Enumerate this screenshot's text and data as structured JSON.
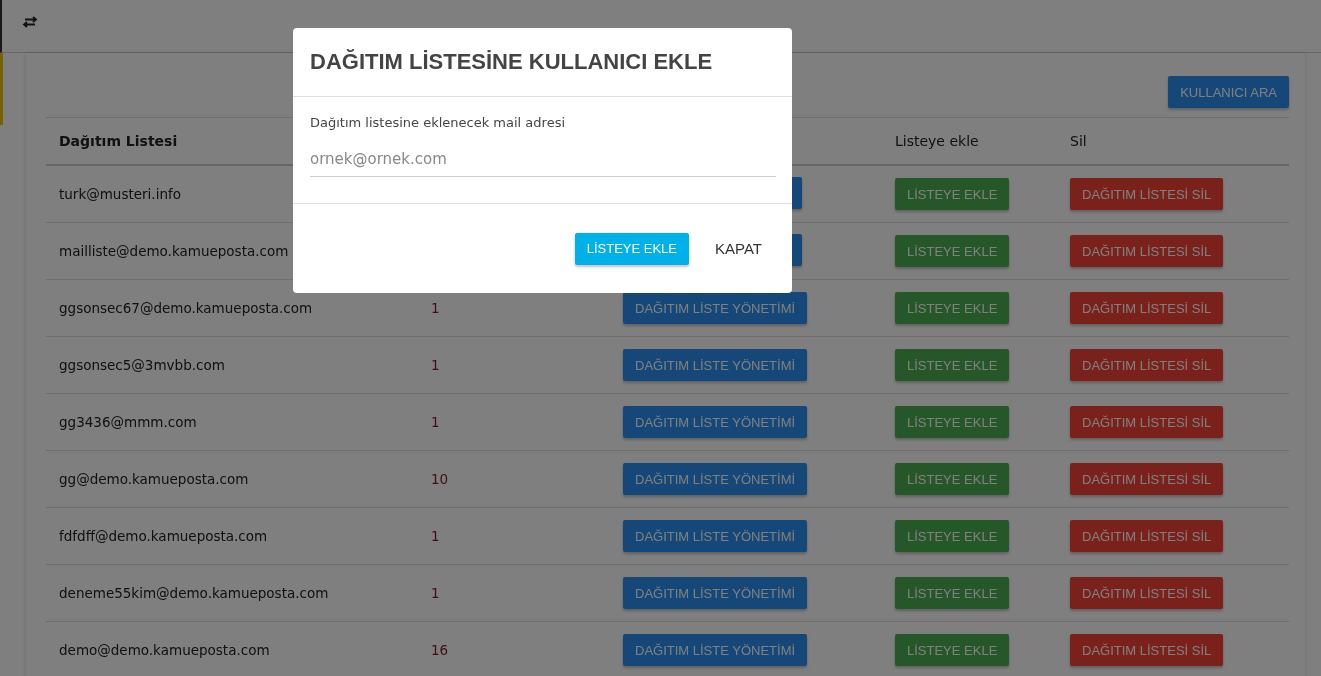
{
  "table": {
    "columns": [
      "Dağıtım Listesi",
      "Listeye ekle",
      "Sil"
    ],
    "search_button": "KULLANICI ARA",
    "rows": [
      {
        "email": "turk@musteri.info",
        "add": "LİSTEYE EKLE",
        "delete": "DAĞITIM LİSTESİ SİL"
      },
      {
        "email": "mailliste@demo.kamueposta.com",
        "add": "LİSTEYE EKLE",
        "delete": "DAĞITIM LİSTESİ SİL"
      },
      {
        "email": "ggsonsec67@demo.kamueposta.com",
        "count": "1",
        "manage": "DAĞITIM LİSTE YÖNETİMİ",
        "add": "LİSTEYE EKLE",
        "delete": "DAĞITIM LİSTESİ SİL"
      },
      {
        "email": "ggsonsec5@3mvbb.com",
        "count": "1",
        "manage": "DAĞITIM LİSTE YÖNETİMİ",
        "add": "LİSTEYE EKLE",
        "delete": "DAĞITIM LİSTESİ SİL"
      },
      {
        "email": "gg3436@mmm.com",
        "count": "1",
        "manage": "DAĞITIM LİSTE YÖNETİMİ",
        "add": "LİSTEYE EKLE",
        "delete": "DAĞITIM LİSTESİ SİL"
      },
      {
        "email": "gg@demo.kamueposta.com",
        "count": "10",
        "manage": "DAĞITIM LİSTE YÖNETİMİ",
        "add": "LİSTEYE EKLE",
        "delete": "DAĞITIM LİSTESİ SİL"
      },
      {
        "email": "fdfdff@demo.kamueposta.com",
        "count": "1",
        "manage": "DAĞITIM LİSTE YÖNETİMİ",
        "add": "LİSTEYE EKLE",
        "delete": "DAĞITIM LİSTESİ SİL"
      },
      {
        "email": "deneme55kim@demo.kamueposta.com",
        "count": "1",
        "manage": "DAĞITIM LİSTE YÖNETİMİ",
        "add": "LİSTEYE EKLE",
        "delete": "DAĞITIM LİSTESİ SİL"
      },
      {
        "email": "demo@demo.kamueposta.com",
        "count": "16",
        "manage": "DAĞITIM LİSTE YÖNETİMİ",
        "add": "LİSTEYE EKLE",
        "delete": "DAĞITIM LİSTESİ SİL"
      }
    ]
  },
  "dialog": {
    "title": "DAĞITIM LİSTESİNE KULLANICI EKLE",
    "field_label": "Dağıtım listesine eklenecek mail adresi",
    "placeholder": "ornek@ornek.com",
    "buttons": [
      "LİSTEYE EKLE",
      "KAPAT"
    ]
  }
}
